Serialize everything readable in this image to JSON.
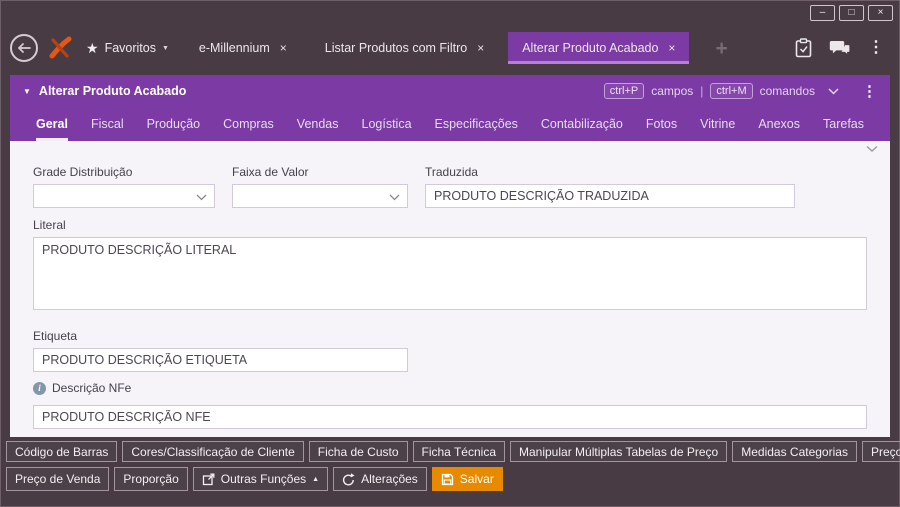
{
  "window_controls": {
    "minimize": "–",
    "maximize": "□",
    "close": "×"
  },
  "topbar": {
    "favorites_label": "Favoritos",
    "star_glyph": "★",
    "caret_glyph": "▼",
    "close_glyph": "×",
    "new_tab_glyph": "+",
    "menu_glyph": "⋮",
    "tabs": [
      {
        "label": "e-Millennium"
      },
      {
        "label": "Listar Produtos com Filtro"
      },
      {
        "label": "Alterar Produto Acabado"
      }
    ]
  },
  "panel": {
    "title": "Alterar Produto Acabado",
    "caret_glyph": "▼",
    "menu_glyph": "⋮",
    "shortcuts": {
      "campos_key": "ctrl+P",
      "campos_label": "campos",
      "separator": "|",
      "comandos_key": "ctrl+M",
      "comandos_label": "comandos"
    },
    "tabs": [
      {
        "label": "Geral"
      },
      {
        "label": "Fiscal"
      },
      {
        "label": "Produção"
      },
      {
        "label": "Compras"
      },
      {
        "label": "Vendas"
      },
      {
        "label": "Logística"
      },
      {
        "label": "Especificações"
      },
      {
        "label": "Contabilização"
      },
      {
        "label": "Fotos"
      },
      {
        "label": "Vitrine"
      },
      {
        "label": "Anexos"
      },
      {
        "label": "Tarefas"
      }
    ]
  },
  "form": {
    "grade_distribuicao": {
      "label": "Grade Distribuição",
      "value": ""
    },
    "faixa_de_valor": {
      "label": "Faixa de Valor",
      "value": ""
    },
    "traduzida": {
      "label": "Traduzida",
      "value": "PRODUTO DESCRIÇÃO TRADUZIDA"
    },
    "literal": {
      "label": "Literal",
      "value": "PRODUTO DESCRIÇÃO LITERAL"
    },
    "etiqueta": {
      "label": "Etiqueta",
      "value": "PRODUTO DESCRIÇÃO ETIQUETA"
    },
    "descricao_nfe": {
      "label": "Descrição NFe",
      "value": "PRODUTO DESCRIÇÃO NFE",
      "info_glyph": "i"
    }
  },
  "footer": {
    "row1": [
      "Código de Barras",
      "Cores/Classificação de Cliente",
      "Ficha de Custo",
      "Ficha Técnica",
      "Manipular Múltiplas Tabelas de Preço",
      "Medidas Categorias",
      "Preço de Custo"
    ],
    "row2_plain": [
      "Preço de Venda",
      "Proporção"
    ],
    "outras_funcoes_label": "Outras Funções",
    "outras_funcoes_caret": "▲",
    "alteracoes_label": "Alterações",
    "salvar_label": "Salvar"
  },
  "colors": {
    "frame": "#483b44",
    "accent_purple": "#7c3aa4",
    "tab_underline": "#b77fd8",
    "save_orange": "#e78a00"
  }
}
